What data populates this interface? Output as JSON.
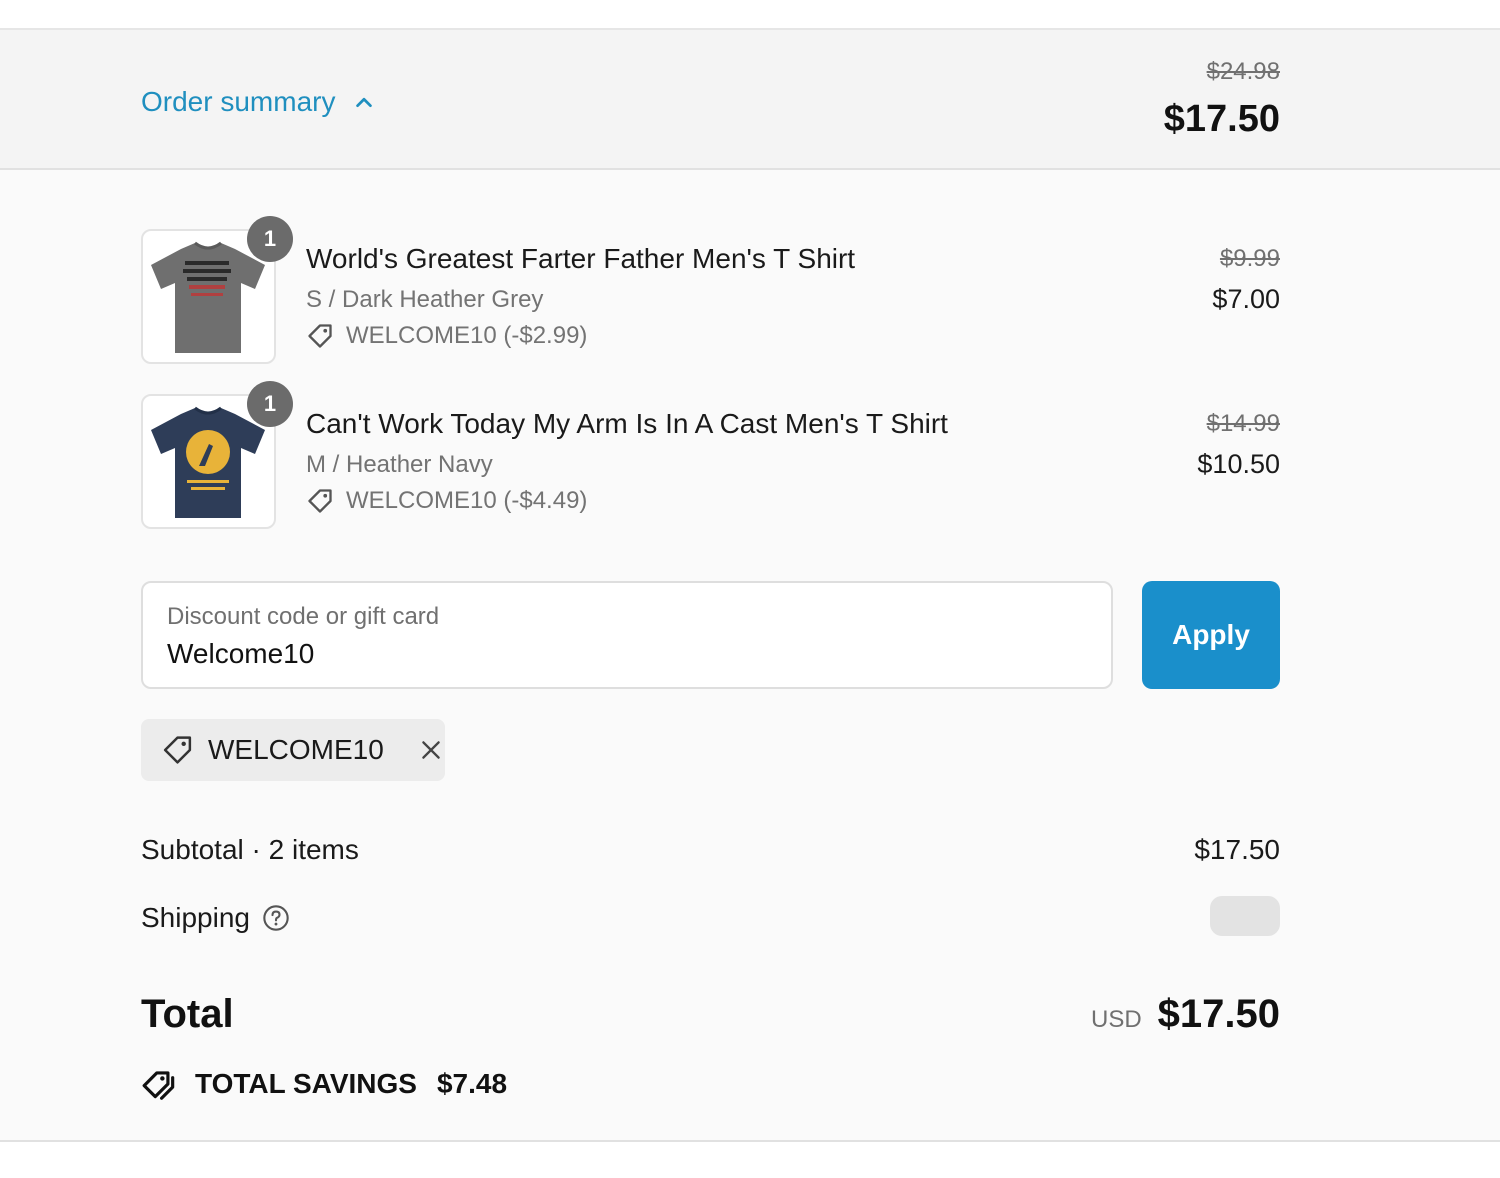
{
  "header": {
    "toggle_label": "Order summary",
    "original_total": "$24.98",
    "total": "$17.50"
  },
  "items": [
    {
      "quantity": "1",
      "name": "World's Greatest Farter Father Men's T Shirt",
      "variant": "S / Dark Heather Grey",
      "discount": "WELCOME10 (-$2.99)",
      "original_price": "$9.99",
      "price": "$7.00",
      "shirt_color": "#6f6f6f"
    },
    {
      "quantity": "1",
      "name": "Can't Work Today My Arm Is In A Cast Men's T Shirt",
      "variant": "M / Heather Navy",
      "discount": "WELCOME10 (-$4.49)",
      "original_price": "$14.99",
      "price": "$10.50",
      "shirt_color": "#2e3d58"
    }
  ],
  "discount_field": {
    "label": "Discount code or gift card",
    "value": "Welcome10"
  },
  "apply_label": "Apply",
  "applied_code": "WELCOME10",
  "subtotal": {
    "label": "Subtotal · 2 items",
    "value": "$17.50"
  },
  "shipping": {
    "label": "Shipping"
  },
  "total": {
    "label": "Total",
    "currency": "USD",
    "value": "$17.50"
  },
  "savings": {
    "label": "TOTAL SAVINGS",
    "value": "$7.48"
  },
  "colors": {
    "accent": "#1a8fcb",
    "link": "#1f8fbf"
  }
}
